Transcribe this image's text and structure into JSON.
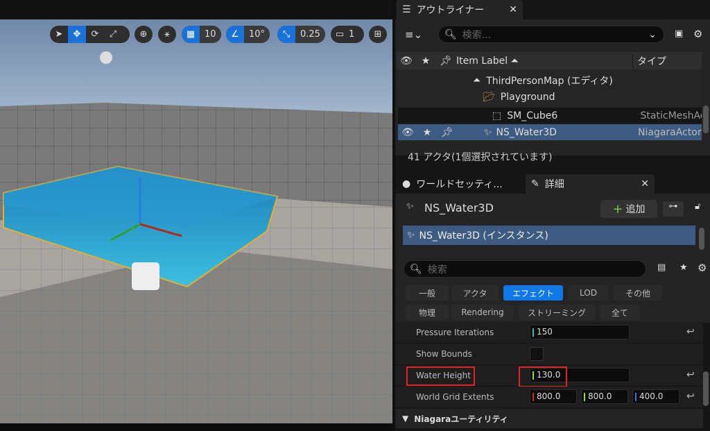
{
  "viewport_toolbar": {
    "grid_snap": "10",
    "rotation_snap": "10°",
    "scale_snap": "0.25",
    "camera_speed": "1"
  },
  "outliner": {
    "tab_label": "アウトライナー",
    "search_placeholder": "検索...",
    "columns": {
      "label": "Item Label",
      "type": "タイプ"
    },
    "rows": [
      {
        "label": "ThirdPersonMap (エディタ)",
        "type": "",
        "icon": "level-icon"
      },
      {
        "label": "Playground",
        "type": "",
        "icon": "folder-icon"
      },
      {
        "label": "SM_Cube6",
        "type": "StaticMeshAc",
        "icon": "static-mesh-icon"
      },
      {
        "label": "NS_Water3D",
        "type": "NiagaraActor",
        "icon": "niagara-icon",
        "selected": true
      }
    ],
    "status": "41 アクタ(1個選択されています)"
  },
  "details": {
    "world_settings_tab": "ワールドセッティ...",
    "details_tab": "詳細",
    "actor_name": "NS_Water3D",
    "add_label": "追加",
    "component_instance": "NS_Water3D (インスタンス)",
    "search_placeholder": "検索",
    "filters": [
      "一般",
      "アクタ",
      "エフェクト",
      "LOD",
      "その他",
      "物理",
      "Rendering",
      "ストリーミング",
      "全て"
    ],
    "active_filter": "エフェクト",
    "properties": {
      "pressure_iterations": {
        "label": "Pressure Iterations",
        "value": "150"
      },
      "show_bounds": {
        "label": "Show Bounds",
        "checked": false
      },
      "water_height": {
        "label": "Water Height",
        "value": "130.0"
      },
      "world_grid_extents": {
        "label": "World Grid Extents",
        "x": "800.0",
        "y": "800.0",
        "z": "400.0"
      }
    },
    "section": "Niagaraユーティリティ"
  },
  "colors": {
    "accent": "#0e78e6",
    "selection": "#3d5a80",
    "highlight": "#e0242c"
  }
}
